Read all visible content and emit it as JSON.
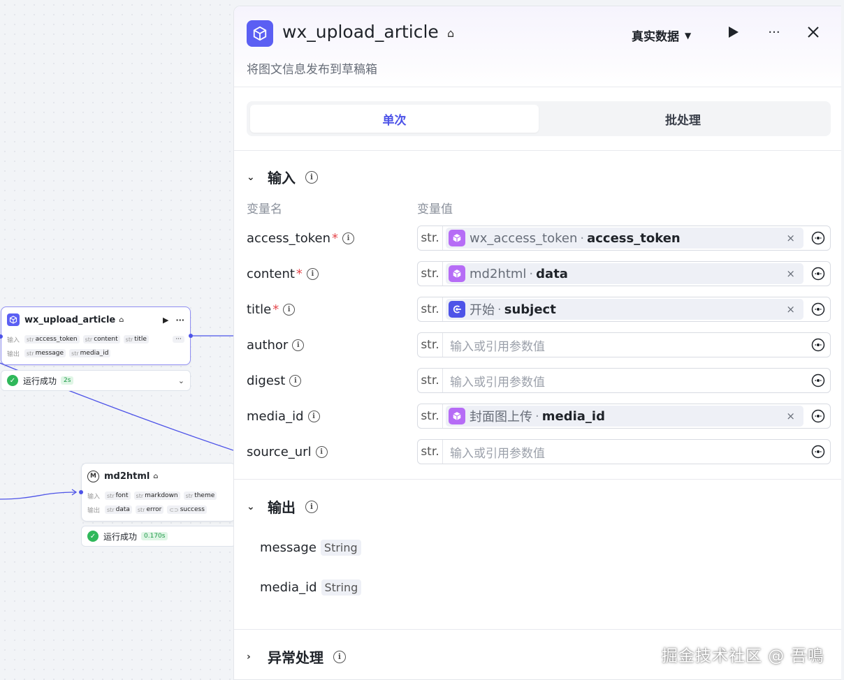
{
  "canvas": {
    "nodes": [
      {
        "title": "wx_upload_article",
        "input_label": "输入",
        "inputs": [
          {
            "type": "str",
            "name": "access_token"
          },
          {
            "type": "str",
            "name": "content"
          },
          {
            "type": "str",
            "name": "title"
          }
        ],
        "more": "···",
        "output_label": "输出",
        "outputs": [
          {
            "type": "str",
            "name": "message"
          },
          {
            "type": "str",
            "name": "media_id"
          }
        ],
        "status_text": "运行成功",
        "duration": "2s"
      },
      {
        "title": "md2html",
        "icon_letter": "M",
        "input_label": "输入",
        "inputs": [
          {
            "type": "str",
            "name": "font"
          },
          {
            "type": "str",
            "name": "markdown"
          },
          {
            "type": "str",
            "name": "theme"
          }
        ],
        "output_label": "输出",
        "outputs": [
          {
            "type": "str",
            "name": "data"
          },
          {
            "type": "str",
            "name": "error"
          },
          {
            "type": "⊂⊃",
            "name": "success"
          }
        ],
        "status_text": "运行成功",
        "duration": "0.170s"
      }
    ]
  },
  "panel": {
    "title": "wx_upload_article",
    "description": "将图文信息发布到草稿箱",
    "mode_label": "真实数据",
    "tabs": [
      {
        "label": "单次",
        "active": true
      },
      {
        "label": "批处理",
        "active": false
      }
    ],
    "input_section": {
      "title": "输入",
      "col_name": "变量名",
      "col_value": "变量值",
      "rows": [
        {
          "name": "access_token",
          "required": true,
          "type": "str.",
          "ref": {
            "node": "wx_access_token",
            "field": "access_token",
            "icon": "cube-icon"
          }
        },
        {
          "name": "content",
          "required": true,
          "type": "str.",
          "ref": {
            "node": "md2html",
            "field": "data",
            "icon": "cube-icon"
          }
        },
        {
          "name": "title",
          "required": true,
          "type": "str.",
          "ref": {
            "node": "开始",
            "field": "subject",
            "icon": "start-icon"
          }
        },
        {
          "name": "author",
          "required": false,
          "type": "str.",
          "placeholder": "输入或引用参数值"
        },
        {
          "name": "digest",
          "required": false,
          "type": "str.",
          "placeholder": "输入或引用参数值"
        },
        {
          "name": "media_id",
          "required": false,
          "type": "str.",
          "ref": {
            "node": "封面图上传",
            "field": "media_id",
            "icon": "cube-icon"
          }
        },
        {
          "name": "source_url",
          "required": false,
          "type": "str.",
          "placeholder": "输入或引用参数值"
        }
      ]
    },
    "output_section": {
      "title": "输出",
      "rows": [
        {
          "name": "message",
          "type": "String"
        },
        {
          "name": "media_id",
          "type": "String"
        }
      ]
    },
    "exception_section": {
      "title": "异常处理"
    }
  },
  "watermark": "掘金技术社区 @ 吾鳴",
  "colors": {
    "accent": "#4d53e8",
    "node_purple": "#b66cf6",
    "success": "#2fb85a",
    "required": "#e5484d"
  }
}
